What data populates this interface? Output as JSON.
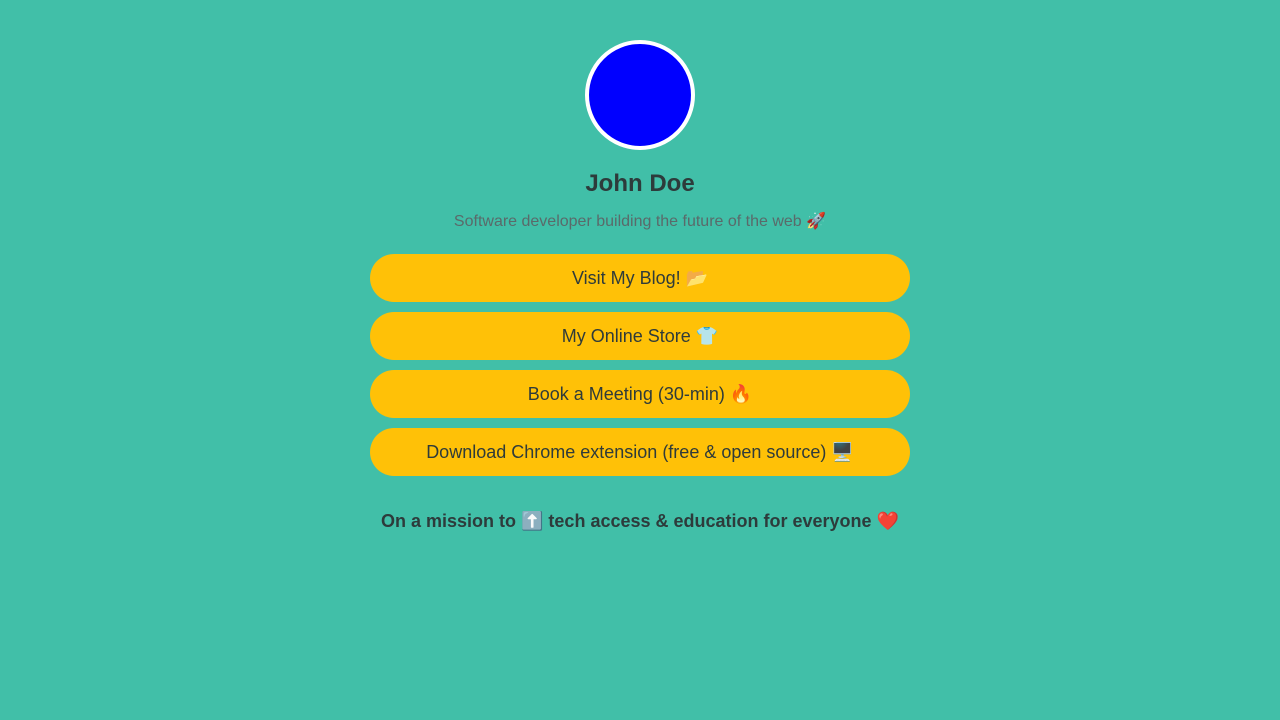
{
  "profile": {
    "avatar_color": "#0000ff",
    "name": "John Doe",
    "bio": "Software developer building the future of the web 🚀"
  },
  "links": [
    {
      "label": "Visit My Blog! 📂"
    },
    {
      "label": "My Online Store 👕"
    },
    {
      "label": "Book a Meeting (30-min) 🔥"
    },
    {
      "label": "Download Chrome extension (free & open source) 🖥️"
    }
  ],
  "footer": {
    "mission": "On a mission to ⬆️ tech access & education for everyone ❤️"
  },
  "colors": {
    "background": "#41bfa8",
    "button": "#ffc107",
    "text": "#2d3b3b"
  }
}
